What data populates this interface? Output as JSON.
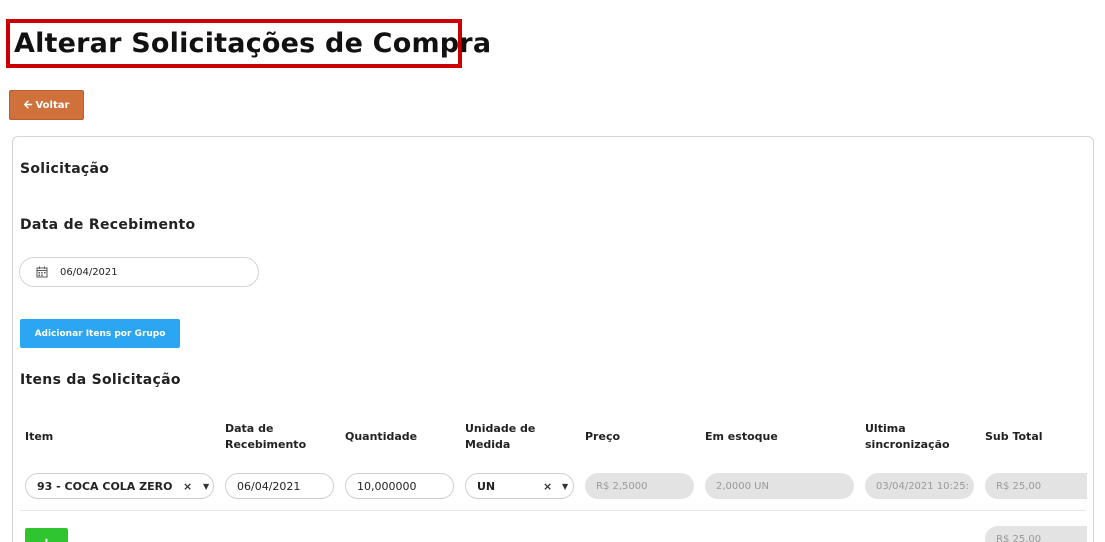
{
  "header": {
    "title": "Alterar Solicitações de Compra"
  },
  "back_button": {
    "label": "Voltar",
    "icon": "arrow-left-icon"
  },
  "form": {
    "section_title": "Solicitação",
    "receive_date_label": "Data de Recebimento",
    "receive_date_value": "06/04/2021",
    "add_by_group_label": "Adicionar Itens por Grupo",
    "items_title": "Itens da Solicitação"
  },
  "table": {
    "headers": {
      "item": "Item",
      "date_l1": "Data de",
      "date_l2": "Recebimento",
      "quantity": "Quantidade",
      "unit_l1": "Unidade de",
      "unit_l2": "Medida",
      "price": "Preço",
      "stock": "Em estoque",
      "sync_l1": "Ultima",
      "sync_l2": "sincronização",
      "subtotal": "Sub Total"
    },
    "rows": [
      {
        "item": "93 - COCA COLA ZERO",
        "receive_date": "06/04/2021",
        "quantity": "10,000000",
        "unit": "UN",
        "price": "R$ 2,5000",
        "stock": "2,0000 UN",
        "last_sync": "03/04/2021 10:25:",
        "subtotal": "R$ 25,00"
      }
    ],
    "total": "R$ 25,00",
    "add_row_label": "+"
  },
  "colors": {
    "title_border": "#cc0000",
    "back_button": "#d0703a",
    "add_group_button": "#2aa6f2",
    "add_row_button": "#2fc52f"
  }
}
